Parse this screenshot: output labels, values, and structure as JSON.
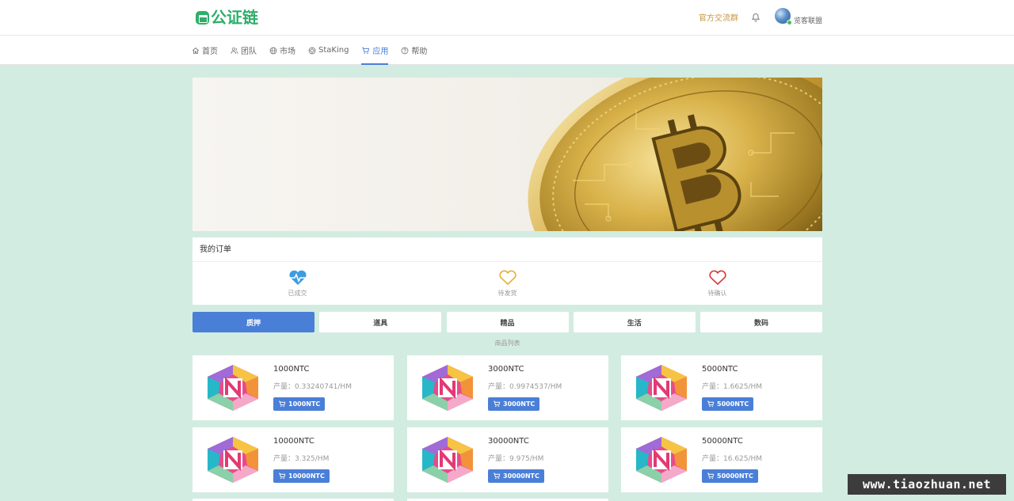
{
  "header": {
    "logo_text": "公证链",
    "group_link": "官方交流群",
    "username": "览客联盟"
  },
  "nav": {
    "items": [
      {
        "label": "首页",
        "icon": "home-icon"
      },
      {
        "label": "团队",
        "icon": "users-icon"
      },
      {
        "label": "市场",
        "icon": "globe-icon"
      },
      {
        "label": "StaKing",
        "icon": "staking-icon"
      },
      {
        "label": "应用",
        "icon": "cart-icon",
        "active": true
      },
      {
        "label": "帮助",
        "icon": "help-icon"
      }
    ]
  },
  "banner": {
    "image": "bitcoin-coin-banner"
  },
  "orders": {
    "title": "我的订单",
    "items": [
      {
        "label": "已成交",
        "icon": "heartbeat-icon",
        "color": "#3f9be0"
      },
      {
        "label": "待发货",
        "icon": "heart-outline-icon",
        "color": "#e6b030"
      },
      {
        "label": "待确认",
        "icon": "heart-outline-icon",
        "color": "#d9383a"
      }
    ]
  },
  "categories": [
    {
      "label": "质押",
      "active": true
    },
    {
      "label": "道具"
    },
    {
      "label": "精品"
    },
    {
      "label": "生活"
    },
    {
      "label": "数码"
    }
  ],
  "products_title": "商品列表",
  "products": [
    {
      "name": "1000NTC",
      "rate": "产量：0.33240741/HM",
      "button": "1000NTC"
    },
    {
      "name": "3000NTC",
      "rate": "产量：0.9974537/HM",
      "button": "3000NTC"
    },
    {
      "name": "5000NTC",
      "rate": "产量：1.6625/HM",
      "button": "5000NTC"
    },
    {
      "name": "10000NTC",
      "rate": "产量：3.325/HM",
      "button": "10000NTC"
    },
    {
      "name": "30000NTC",
      "rate": "产量：9.975/HM",
      "button": "30000NTC"
    },
    {
      "name": "50000NTC",
      "rate": "产量：16.625/HM",
      "button": "50000NTC"
    }
  ],
  "watermark": "www.tiaozhuan.net",
  "colors": {
    "brand": "#2fae6b",
    "accent": "#4a7fd8",
    "background": "#d3ece2"
  }
}
